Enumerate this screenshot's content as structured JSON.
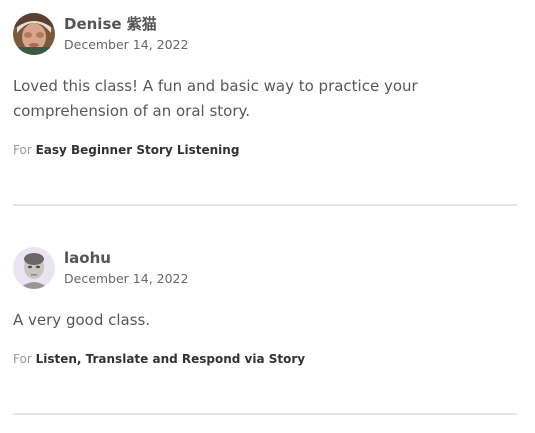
{
  "reviews": [
    {
      "author": "Denise 紫猫",
      "date": "December 14, 2022",
      "comment": "Loved this class! A fun and basic way to practice your comprehension of an oral story.",
      "for_label": "For",
      "course": "Easy Beginner Story Listening"
    },
    {
      "author": "laohu",
      "date": "December 14, 2022",
      "comment": "A very good class.",
      "for_label": "For",
      "course": "Listen, Translate and Respond via Story"
    }
  ]
}
